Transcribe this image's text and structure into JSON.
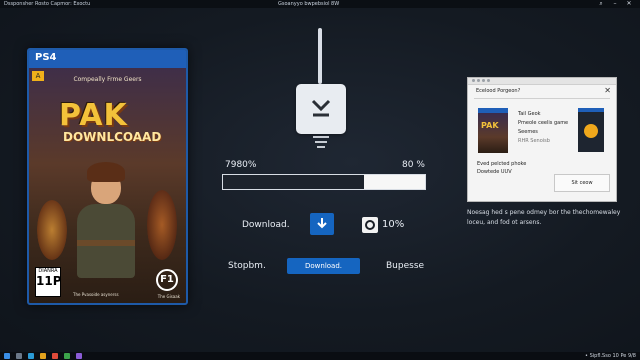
{
  "window": {
    "title_left": "Dssponsher Rosto Capmor: Exoctu",
    "title_center": "Gsoanyyo bwpebsiol 8W"
  },
  "cover": {
    "platform": "PS4",
    "subtitle": "Compeally Frme Geers",
    "logo_main": "PAK",
    "logo_sub": "DOWNLCOAAD",
    "rating_top": "A",
    "rating_label": "DIANRA",
    "rating_value": "11P",
    "badge": "F1",
    "footer_left": "The Pvasoide asynerss",
    "footer_right": "The Gisaak"
  },
  "progress": {
    "left_label": "7980%",
    "right_label": "80 %",
    "fraction": 0.7
  },
  "controls": {
    "download_label": "Download.",
    "percent_label": "10%",
    "stop_label": "Stopbm.",
    "download_button": "Download.",
    "pause_label": "Bupesse"
  },
  "dialog": {
    "title": "Ecelood Porgeon?",
    "close": "✕",
    "thumb_text": "PAK",
    "info_line1": "Tail Geok",
    "info_line2": "Pmeole ceelis game",
    "info_line3": "Seemes",
    "info_line4": "RHR Senoisb",
    "text_line1": "Eved pelcted phoke",
    "text_line2": "Dowtede UUV",
    "button": "Sit ceow"
  },
  "side_note": "Noesag hed s pene odmey bor the thechomewaley loceu, and fod ot arsens.",
  "taskbar": {
    "clock": "• Sipfl.Sso 10 Pe 9/8"
  },
  "colors": {
    "accent": "#1565c0",
    "cover_border": "#1e5aa8",
    "background": "#141a22"
  }
}
